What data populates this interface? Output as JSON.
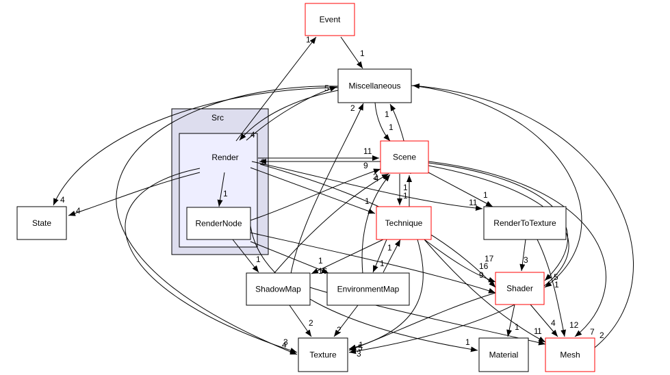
{
  "colors": {
    "highlight_border": "#ff0000",
    "normal_border": "#000000",
    "outer_cluster_fill": "#ddddee",
    "inner_cluster_fill": "#eeeeff",
    "edge": "#000000"
  },
  "clusters": {
    "outer": "Src",
    "inner": "Render"
  },
  "nodes": {
    "event": "Event",
    "misc": "Miscellaneous",
    "rendernode": "RenderNode",
    "state": "State",
    "scene": "Scene",
    "technique": "Technique",
    "rtt": "RenderToTexture",
    "shadowmap": "ShadowMap",
    "envmap": "EnvironmentMap",
    "shader": "Shader",
    "texture": "Texture",
    "material": "Material",
    "mesh": "Mesh"
  },
  "edges": [
    {
      "from": "Render",
      "to": "Event",
      "label": "1"
    },
    {
      "from": "Event",
      "to": "Miscellaneous",
      "label": "1"
    },
    {
      "from": "Render",
      "to": "Miscellaneous",
      "label": "5"
    },
    {
      "from": "Miscellaneous",
      "to": "Render",
      "label": "4"
    },
    {
      "from": "Miscellaneous",
      "to": "Scene",
      "label": "1"
    },
    {
      "from": "Scene",
      "to": "Miscellaneous",
      "label": "1"
    },
    {
      "from": "Miscellaneous",
      "to": "State",
      "label": "4"
    },
    {
      "from": "Render",
      "to": "State",
      "label": "4"
    },
    {
      "from": "Render",
      "to": "Scene",
      "label": "11"
    },
    {
      "from": "RenderNode",
      "to": "Scene",
      "label": "9"
    },
    {
      "from": "Scene",
      "to": "Render",
      "label": "2"
    },
    {
      "from": "Scene",
      "to": "Technique",
      "label": "1"
    },
    {
      "from": "Technique",
      "to": "Scene",
      "label": "1"
    },
    {
      "from": "Render",
      "to": "Technique",
      "label": "1"
    },
    {
      "from": "ShadowMap",
      "to": "Miscellaneous",
      "label": "2"
    },
    {
      "from": "ShadowMap",
      "to": "Scene",
      "label": "2"
    },
    {
      "from": "EnvironmentMap",
      "to": "Scene",
      "label": "4"
    },
    {
      "from": "Render",
      "to": "RenderNode",
      "label": "1"
    },
    {
      "from": "Render",
      "to": "RenderToTexture",
      "label": "11"
    },
    {
      "from": "Scene",
      "to": "RenderToTexture",
      "label": "1"
    },
    {
      "from": "RenderNode",
      "to": "ShadowMap",
      "label": "1"
    },
    {
      "from": "RenderNode",
      "to": "EnvironmentMap",
      "label": "1"
    },
    {
      "from": "Technique",
      "to": "ShadowMap",
      "label": "16"
    },
    {
      "from": "Technique",
      "to": "EnvironmentMap",
      "label": "1"
    },
    {
      "from": "EnvironmentMap",
      "to": "Technique",
      "label": "1"
    },
    {
      "from": "RenderToTexture",
      "to": "Shader",
      "label": "3"
    },
    {
      "from": "Technique",
      "to": "Shader",
      "label": "17"
    },
    {
      "from": "Render",
      "to": "Shader",
      "label": "16"
    },
    {
      "from": "RenderNode",
      "to": "Shader",
      "label": "9"
    },
    {
      "from": "Scene",
      "to": "Shader",
      "label": "5"
    },
    {
      "from": "Miscellaneous",
      "to": "Shader",
      "label": "1"
    },
    {
      "from": "Shader",
      "to": "Material",
      "label": "1"
    },
    {
      "from": "Shader",
      "to": "Mesh",
      "label": "4"
    },
    {
      "from": "RenderToTexture",
      "to": "Mesh",
      "label": "12"
    },
    {
      "from": "Scene",
      "to": "Mesh",
      "label": "7"
    },
    {
      "from": "Mesh",
      "to": "Miscellaneous",
      "label": "2"
    },
    {
      "from": "ShadowMap",
      "to": "Texture",
      "label": "2"
    },
    {
      "from": "EnvironmentMap",
      "to": "Texture",
      "label": "2"
    },
    {
      "from": "Render",
      "to": "Texture",
      "label": "3"
    },
    {
      "from": "Miscellaneous",
      "to": "Texture",
      "label": "4"
    },
    {
      "from": "Technique",
      "to": "Texture",
      "label": "1"
    },
    {
      "from": "Scene",
      "to": "Texture",
      "label": "5"
    },
    {
      "from": "Shader",
      "to": "Texture",
      "label": "3"
    },
    {
      "from": "RenderNode",
      "to": "Material",
      "label": "1"
    },
    {
      "from": "Technique",
      "to": "Mesh",
      "label": "1"
    },
    {
      "from": "ShadowMap",
      "to": "Mesh",
      "label": "1"
    }
  ]
}
